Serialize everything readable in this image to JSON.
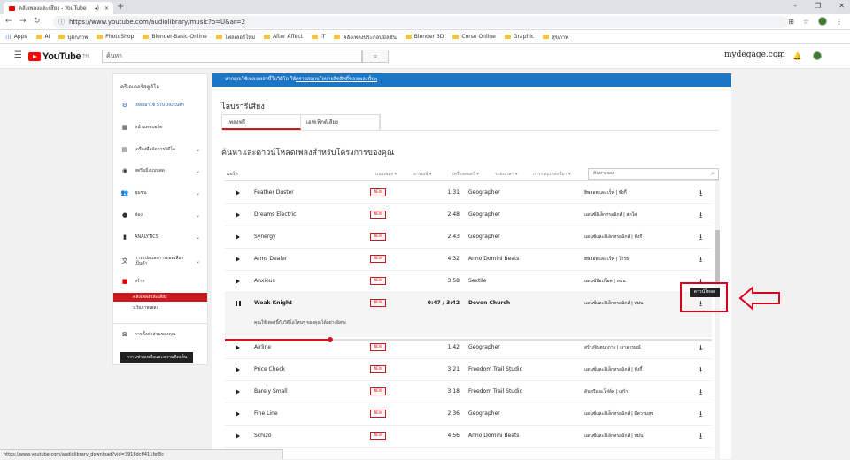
{
  "browser": {
    "tab_title": "คลังเพลงและเสียง - YouTube",
    "url": "https://www.youtube.com/audiolibrary/music?o=U&ar=2",
    "bookmarks": [
      "Apps",
      "AI",
      "บุคิกภาพ",
      "PhotoShop",
      "Blender-Basic-Online",
      "ไฟลเลอร์ใหม่",
      "After Affect",
      "IT",
      "คลังเพลงประกอบมิลชัน",
      "Blender 3D",
      "Corse Online",
      "Graphic",
      "สุขภาพ"
    ],
    "status_url": "https://www.youtube.com/audiolibrary_download?vid=3918dcff411fef8c"
  },
  "yt": {
    "logo": "YouTube",
    "logo_sup": "TH",
    "search_placeholder": "ค้นหา",
    "brand_text": "mydegage.com"
  },
  "sidebar": {
    "title": "ครีเอเตอร์สตูดิโอ",
    "items": [
      {
        "icon": "⚙",
        "label": "เหลอมาใช้ STUDIO เบต้า",
        "chev": ""
      },
      {
        "icon": "▦",
        "label": "หน้าแดชบอร์ด",
        "chev": ""
      },
      {
        "icon": "▤",
        "label": "เครื่องมือจัดการวิดีโอ",
        "chev": "⌄"
      },
      {
        "icon": "◉",
        "label": "สตรีมมิ่งแบบสด",
        "chev": "⌄"
      },
      {
        "icon": "👥",
        "label": "ชุมชน",
        "chev": "⌄"
      },
      {
        "icon": "●",
        "label": "ช่อง",
        "chev": "⌄"
      },
      {
        "icon": "▮",
        "label": "ANALYTICS",
        "chev": "⌄"
      },
      {
        "icon": "文",
        "label": "การแปลและการถอดเสียงเป็นคำ",
        "chev": "⌄"
      },
      {
        "icon": "■",
        "label": "สร้าง",
        "chev": ""
      }
    ],
    "subitems": [
      "คลังเพลงและเสียง",
      "นวัยภาพเพลง"
    ],
    "feedback": "การตั้งค่าส่วนของคุณ",
    "help_button": "ความช่วยเหลือและความคิดเห็น"
  },
  "banner": {
    "text": "หากคุณใช้เพลงเหล่านี้ในวิดีโอ ให้",
    "link": "ตรวจสอบนโยบายลิขสิทธิ์ของเพลงนั้นๆ"
  },
  "library": {
    "title": "ไลบรารีเสียง",
    "tabs": [
      "เพลงฟรี",
      "เอฟเฟ็กต์เสียง"
    ],
    "heading": "ค้นหาและดาวน์โหลดเพลงสำหรับโครงการของคุณ",
    "filters": [
      "แชร์ท",
      "แนวเพลง",
      "อารมณ์",
      "เครื่องดนตรี",
      "ระยะเวลา",
      "การระบุแหล่งที่มา"
    ],
    "filter_search_placeholder": "ค้นหาเพลง"
  },
  "tracks": [
    {
      "name": "Feather Duster",
      "new": "NEW",
      "duration": "1:31",
      "artist": "Geographer",
      "genre": "ฮิพฮอพและแร็พ | ฟังกี้"
    },
    {
      "name": "Dreams Electric",
      "new": "NEW",
      "duration": "2:48",
      "artist": "Geographer",
      "genre": "แดนซ์อิเล็กทรอนิกส์ | สดใส"
    },
    {
      "name": "Synergy",
      "new": "NEW",
      "duration": "2:43",
      "artist": "Geographer",
      "genre": "แดนซ์และอิเล็กทรอนิกส์ | ฟังกี้"
    },
    {
      "name": "Arms Dealer",
      "new": "NEW",
      "duration": "4:32",
      "artist": "Anno Domini Beats",
      "genre": "ฮิพฮอพและแร็พ | โกรธ"
    },
    {
      "name": "Anxious",
      "new": "NEW",
      "duration": "3:58",
      "artist": "Sextile",
      "genre": "แดนซ์ป๊อปร็อค | หม่น"
    },
    {
      "name": "Weak Knight",
      "new": "NEW",
      "duration": "0:47 / 3:42",
      "artist": "Devon Church",
      "genre": "แดนซ์และอิเล็กทรอนิกส์ | หม่น",
      "meta": "คุณใช้เพลงนี้กับวิดีโอไหนๆ ของคุณได้อย่างอิสระ",
      "progress": 0.216
    },
    {
      "name": "Airline",
      "new": "NEW",
      "duration": "1:42",
      "artist": "Geographer",
      "genre": "สร้างจินตนาการ | เร่าอารมณ์"
    },
    {
      "name": "Price Check",
      "new": "NEW",
      "duration": "3:21",
      "artist": "Freedom Trail Studio",
      "genre": "แดนซ์และอิเล็กทรอนิกส์ | ฟังกี้"
    },
    {
      "name": "Barely Small",
      "new": "NEW",
      "duration": "3:18",
      "artist": "Freedom Trail Studio",
      "genre": "ดันทรีและโฟล์ค | เศร้า"
    },
    {
      "name": "Fine Line",
      "new": "NEW",
      "duration": "2:36",
      "artist": "Geographer",
      "genre": "แดนซ์และอิเล็กทรอนิกส์ | มีความสุข"
    },
    {
      "name": "Schizo",
      "new": "NEW",
      "duration": "4:56",
      "artist": "Anno Domini Beats",
      "genre": "แดนซ์และอิเล็กทรอนิกส์ | หม่น"
    }
  ],
  "tooltip": "ดาวน์โหลด",
  "colors": {
    "yt_red": "#cc181e",
    "banner_blue": "#1c76c7",
    "annotation_red": "#d9001b"
  }
}
